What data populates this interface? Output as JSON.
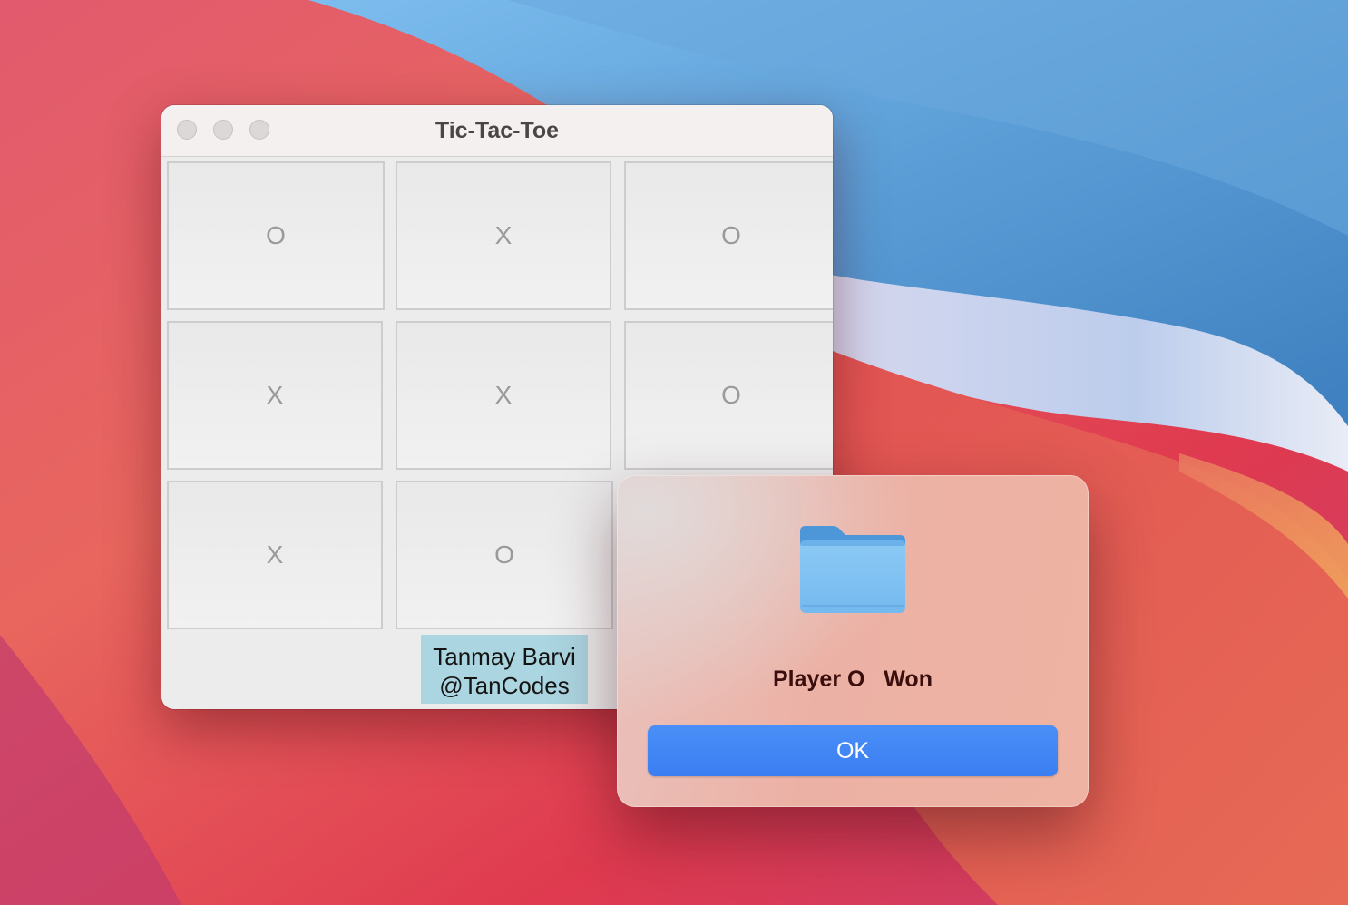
{
  "window": {
    "title": "Tic-Tac-Toe"
  },
  "board": {
    "cells": [
      "O",
      "X",
      "O",
      "X",
      "X",
      "O",
      "X",
      "O",
      ""
    ]
  },
  "credit": {
    "line1": "Tanmay Barvi",
    "line2": "@TanCodes"
  },
  "dialog": {
    "icon": "folder-icon",
    "message": "Player O   Won",
    "ok_label": "OK"
  },
  "colors": {
    "accent_button": "#3a7ef2",
    "credit_background": "#abd5e0",
    "wallpaper_red": "#e2434f",
    "wallpaper_blue": "#4f95d0"
  }
}
